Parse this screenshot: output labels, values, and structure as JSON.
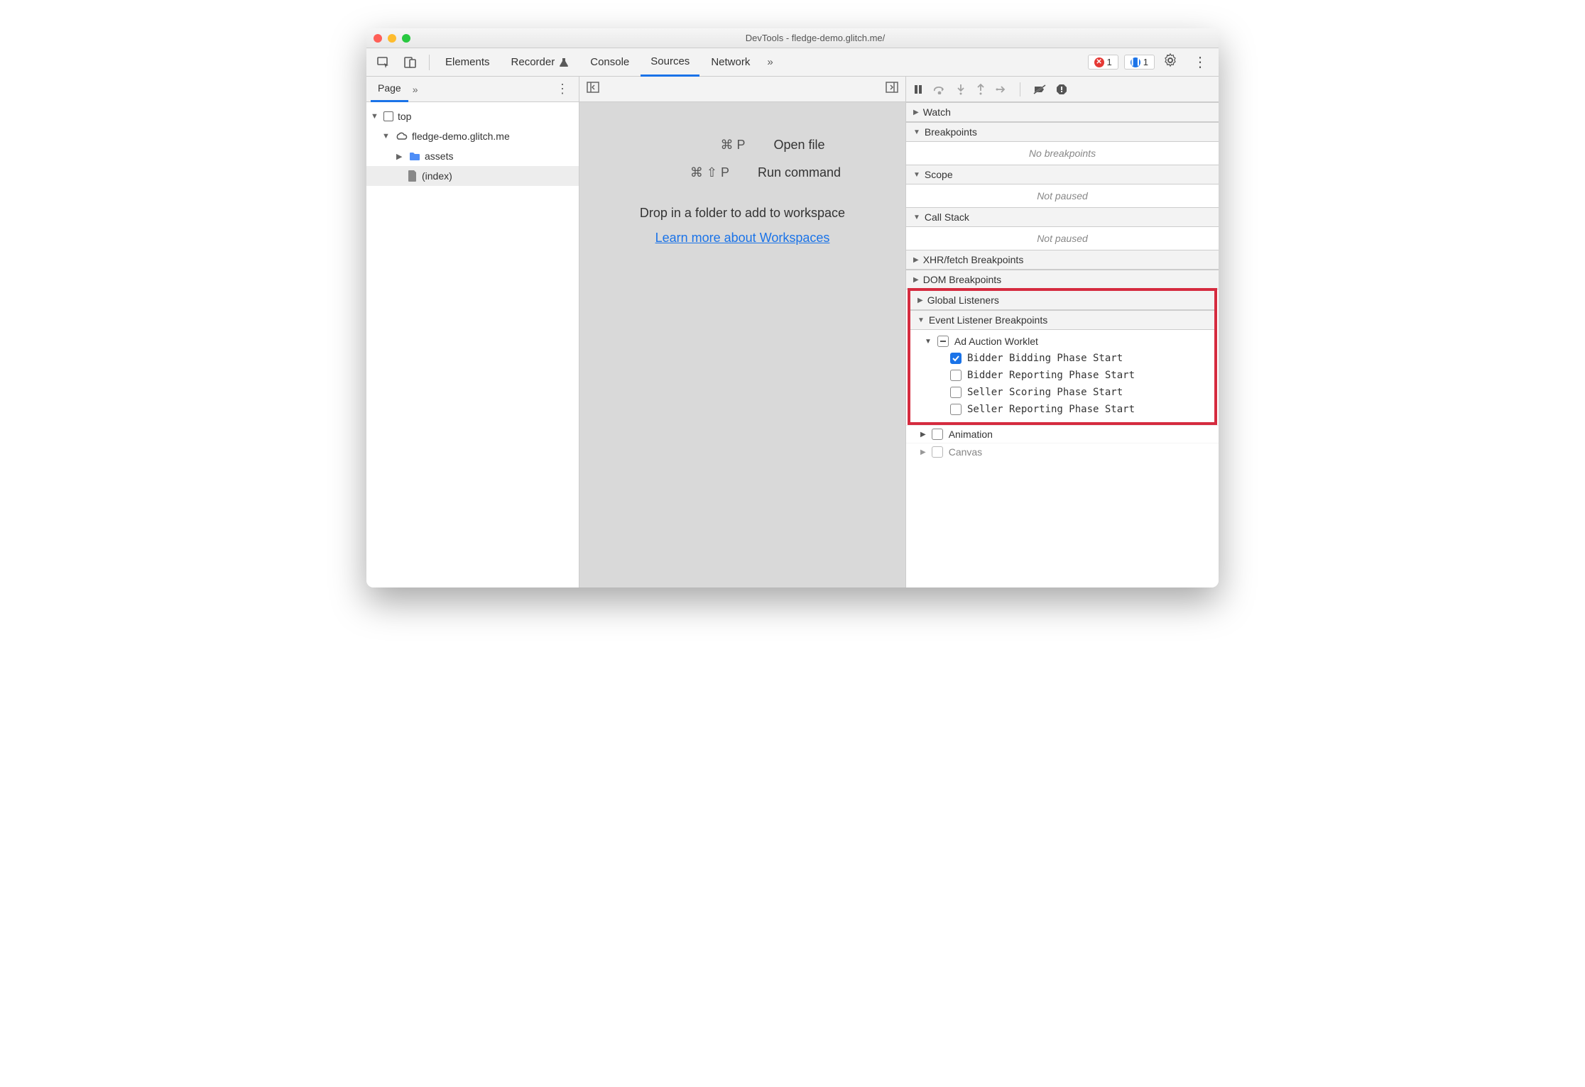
{
  "window": {
    "title": "DevTools - fledge-demo.glitch.me/"
  },
  "toolbar": {
    "tabs": [
      "Elements",
      "Recorder",
      "Console",
      "Sources",
      "Network"
    ],
    "active": "Sources",
    "errors": "1",
    "issues": "1"
  },
  "left": {
    "tab": "Page",
    "tree": {
      "top": "top",
      "origin": "fledge-demo.glitch.me",
      "folder": "assets",
      "file": "(index)"
    }
  },
  "mid": {
    "open_kbd": "⌘ P",
    "open_label": "Open file",
    "run_kbd": "⌘ ⇧ P",
    "run_label": "Run command",
    "drop_hint": "Drop in a folder to add to workspace",
    "learn_link": "Learn more about Workspaces"
  },
  "right": {
    "watch": "Watch",
    "breakpoints": "Breakpoints",
    "no_bp": "No breakpoints",
    "scope": "Scope",
    "not_paused": "Not paused",
    "callstack": "Call Stack",
    "not_paused2": "Not paused",
    "xhr": "XHR/fetch Breakpoints",
    "dom": "DOM Breakpoints",
    "global": "Global Listeners",
    "elb_header": "Event Listener Breakpoints",
    "elb": {
      "category": "Ad Auction Worklet",
      "items": [
        {
          "label": "Bidder Bidding Phase Start",
          "checked": true
        },
        {
          "label": "Bidder Reporting Phase Start",
          "checked": false
        },
        {
          "label": "Seller Scoring Phase Start",
          "checked": false
        },
        {
          "label": "Seller Reporting Phase Start",
          "checked": false
        }
      ]
    },
    "animation": "Animation",
    "canvas": "Canvas"
  }
}
